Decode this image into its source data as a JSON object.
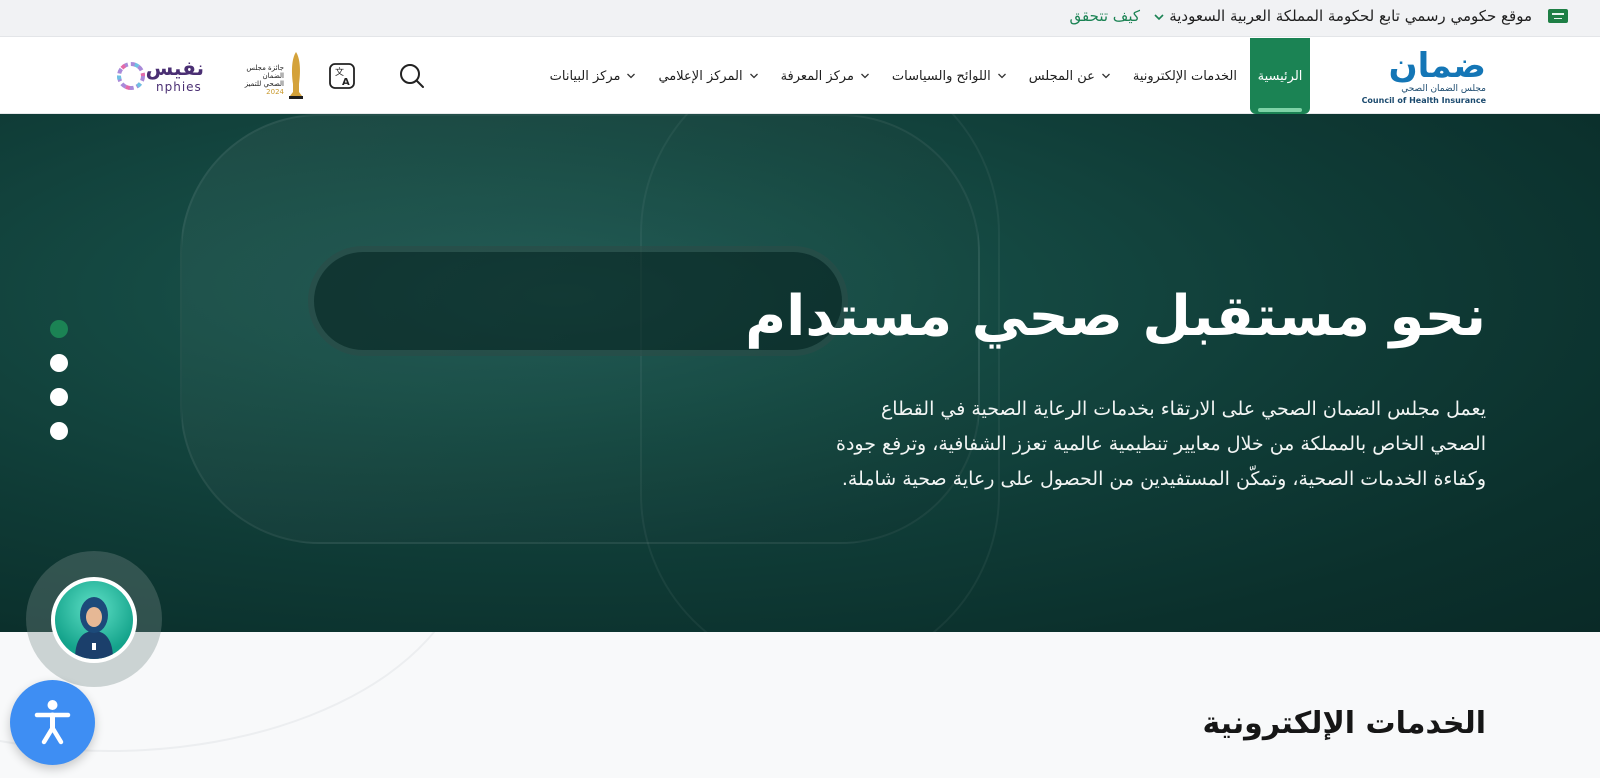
{
  "gov_bar": {
    "text": "موقع حكومي رسمي تابع لحكومة المملكة العربية السعودية",
    "verify_label": "كيف تتحقق",
    "flag_icon": "saudi-flag-icon"
  },
  "header": {
    "logo": {
      "arabic": "ضمان",
      "subtitle": "مجلس الضمان الصحي",
      "english": "Council of Health Insurance"
    },
    "nav": [
      {
        "label": "الرئيسية",
        "active": true,
        "dropdown": false
      },
      {
        "label": "الخدمات الإلكترونية",
        "active": false,
        "dropdown": false
      },
      {
        "label": "عن المجلس",
        "active": false,
        "dropdown": true
      },
      {
        "label": "اللوائح والسياسات",
        "active": false,
        "dropdown": true
      },
      {
        "label": "مركز المعرفة",
        "active": false,
        "dropdown": true
      },
      {
        "label": "المركز الإعلامي",
        "active": false,
        "dropdown": true
      },
      {
        "label": "مركز البيانات",
        "active": false,
        "dropdown": true
      }
    ],
    "award": {
      "text": "جائزة مجلس الضمان الصحي للتميز",
      "year": "2024"
    },
    "nphies": {
      "arabic": "نفيس",
      "english": "nphies"
    }
  },
  "hero": {
    "title": "نحو مستقبل صحي مستدام",
    "description": "يعمل مجلس الضمان الصحي على الارتقاء بخدمات الرعاية الصحية في القطاع الصحي الخاص بالمملكة من خلال معايير تنظيمية عالمية تعزز الشفافية، وترفع جودة وكفاءة الخدمات الصحية، وتمكّن المستفيدين من الحصول على رعاية صحية شاملة.",
    "slides": 4,
    "active_slide": 1
  },
  "section": {
    "title": "الخدمات الإلكترونية"
  },
  "colors": {
    "brand_green": "#1b8354",
    "brand_blue": "#1476b6",
    "hero_dark": "#0f3b36",
    "a11y_blue": "#3e8ef3"
  }
}
